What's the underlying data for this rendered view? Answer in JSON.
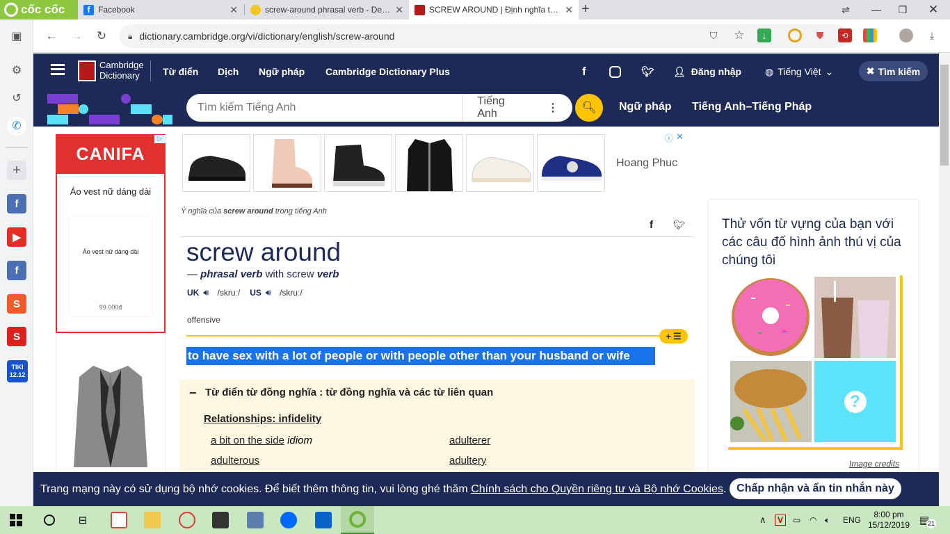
{
  "browser": {
    "brand": "cốc cốc",
    "tabs": [
      {
        "label": "Facebook",
        "icon": "facebook-icon"
      },
      {
        "label": "screw-around phrasal verb - Defini",
        "icon": "bee-icon"
      },
      {
        "label": "SCREW AROUND | Định nghĩa trong",
        "icon": "cambridge-icon"
      }
    ],
    "new_tab": "+",
    "url": "dictionary.cambridge.org/vi/dictionary/english/screw-around"
  },
  "header": {
    "logo_line1": "Cambridge",
    "logo_line2": "Dictionary",
    "nav": [
      "Từ điển",
      "Dịch",
      "Ngữ pháp",
      "Cambridge Dictionary Plus"
    ],
    "login": "Đăng nhập",
    "language": "Tiếng Việt",
    "search_toggle": "Tìm kiếm"
  },
  "search": {
    "placeholder": "Tìm kiếm Tiếng Anh",
    "language": "Tiếng Anh",
    "links": [
      "Ngữ pháp",
      "Tiếng Anh–Tiếng Pháp"
    ]
  },
  "left_ad": {
    "brand": "CANIFA",
    "title": "Áo vest nữ dáng dài",
    "card_title": "Áo vest nữ dáng dài",
    "price": "99.000đ"
  },
  "top_ad": {
    "store": "Hoang Phuc"
  },
  "entry": {
    "meaning_prefix": "Ý nghĩa của",
    "meaning_word": "screw around",
    "meaning_suffix": "trong tiếng Anh",
    "headword": "screw around",
    "dash": "—",
    "pos": "phrasal verb",
    "with_word": "with screw",
    "verb": "verb",
    "uk": "UK",
    "us": "US",
    "pron_uk": "/skruː/",
    "pron_us": "/skruː/",
    "label": "offensive",
    "plus_btn": "+",
    "definition": "to have sex with a lot of people or with people other than your husband or wife"
  },
  "synonyms": {
    "collapse": "−",
    "title": "Từ điển từ đồng nghĩa : từ đồng nghĩa và các từ liên quan",
    "topic": "Relationships: infidelity",
    "items": [
      {
        "word": "a bit on the side",
        "note": "idiom"
      },
      {
        "word": "adulterer",
        "note": ""
      },
      {
        "word": "adulterous",
        "note": ""
      },
      {
        "word": "adultery",
        "note": ""
      }
    ]
  },
  "quiz": {
    "title": "Thử vốn từ vựng của bạn với các câu đố hình ảnh thú vị của chúng tôi",
    "credits": "Image credits",
    "question": "?"
  },
  "cookie": {
    "text": "Trang mạng này có sử dụng bộ nhớ cookies. Để biết thêm thông tin, vui lòng ghé thăm",
    "link": "Chính sách cho Quyền riêng tư và Bộ nhớ Cookies",
    "period": ".",
    "button": "Chấp nhận và ẩn tin nhắn này"
  },
  "taskbar": {
    "lang": "ENG",
    "time": "8:00 pm",
    "date": "15/12/2019",
    "notifications": "21",
    "tiki_top": "TIKI",
    "tiki_bottom": "12.12"
  },
  "colors": {
    "cambridge_navy": "#1d2a57",
    "cambridge_yellow": "#fec400",
    "highlight_blue": "#1a73e8",
    "coccoc_green": "#8dc63f",
    "taskbar_green": "#c9e7c0"
  }
}
